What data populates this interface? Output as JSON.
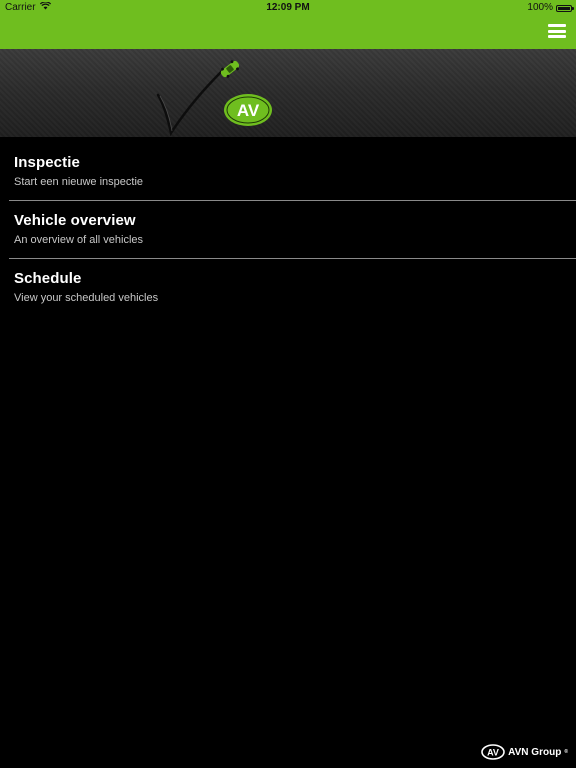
{
  "status_bar": {
    "carrier": "Carrier",
    "time": "12:09 PM",
    "battery": "100%",
    "battery_level": 1.0,
    "wifi_icon": "wifi-icon",
    "battery_icon": "battery-icon"
  },
  "nav_bar": {
    "color": "#6fbe1f",
    "menu_icon": "hamburger-menu-icon"
  },
  "banner": {
    "logo_text": "AV"
  },
  "menu": {
    "items": [
      {
        "title": "Inspectie",
        "subtitle": "Start een nieuwe inspectie"
      },
      {
        "title": "Vehicle overview",
        "subtitle": "An overview of all vehicles"
      },
      {
        "title": "Schedule",
        "subtitle": "View your scheduled vehicles"
      }
    ]
  },
  "footer": {
    "brand_mark": "AV",
    "brand_name": "AVN Group",
    "brand_suffix": "®"
  }
}
